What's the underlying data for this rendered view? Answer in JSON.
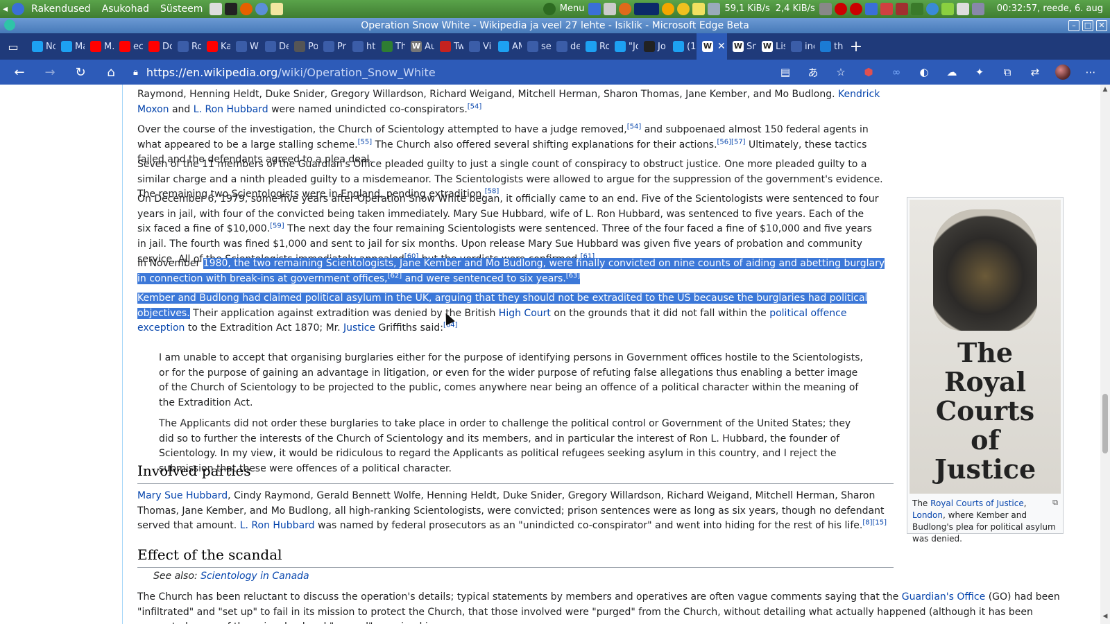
{
  "os_panel": {
    "menus": [
      "Rakendused",
      "Asukohad",
      "Süsteem"
    ],
    "menu_label": "Menu",
    "net_down": "59,1 KiB/s",
    "net_up": "2,4 KiB/s",
    "clock": "00:32:57, reede, 6. aug"
  },
  "window": {
    "title": "Operation Snow White - Wikipedia ja veel 27 lehte - Isiklik - Microsoft Edge Beta"
  },
  "tabs": [
    {
      "label": "No",
      "icon": "twitter-icon",
      "color": "#1da1f2"
    },
    {
      "label": "Ma",
      "icon": "twitter-icon",
      "color": "#1da1f2"
    },
    {
      "label": "M.",
      "icon": "youtube-icon",
      "color": "#ff0000"
    },
    {
      "label": "ec",
      "icon": "youtube-icon",
      "color": "#ff0000"
    },
    {
      "label": "Do",
      "icon": "youtube-icon",
      "color": "#ff0000"
    },
    {
      "label": "Ro",
      "icon": "speaker-icon",
      "color": "#3b5da8"
    },
    {
      "label": "Ka",
      "icon": "youtube-icon",
      "color": "#ff0000"
    },
    {
      "label": "W",
      "icon": "trash-icon",
      "color": "#3b5da8"
    },
    {
      "label": "De",
      "icon": "globe-icon",
      "color": "#3b5da8"
    },
    {
      "label": "Po",
      "icon": "bookmark-icon",
      "color": "#555555"
    },
    {
      "label": "Pr",
      "icon": "cloud-icon",
      "color": "#3b5da8"
    },
    {
      "label": "ht",
      "icon": "page-icon",
      "color": "#3b5da8"
    },
    {
      "label": "Th",
      "icon": "green-icon",
      "color": "#2e7d32"
    },
    {
      "label": "Au",
      "icon": "wikipedia-icon",
      "color": "#777777"
    },
    {
      "label": "Tw",
      "icon": "gmail-icon",
      "color": "#c5221f"
    },
    {
      "label": "Vi",
      "icon": "plane-icon",
      "color": "#3b5da8"
    },
    {
      "label": "AM",
      "icon": "twitter-icon",
      "color": "#1da1f2"
    },
    {
      "label": "se",
      "icon": "lock-doc-icon",
      "color": "#3b5da8"
    },
    {
      "label": "de",
      "icon": "circle-icon",
      "color": "#3b5da8"
    },
    {
      "label": "Ro",
      "icon": "twitter-icon",
      "color": "#1da1f2"
    },
    {
      "label": "\"Jo",
      "icon": "twitter-icon",
      "color": "#1da1f2"
    },
    {
      "label": "Jo",
      "icon": "gp-icon",
      "color": "#222222"
    },
    {
      "label": "(1",
      "icon": "twitter-icon",
      "color": "#1da1f2"
    },
    {
      "label": "",
      "icon": "wikipedia-icon",
      "color": "#ffffff",
      "active": true
    },
    {
      "label": "Sn",
      "icon": "wikipedia-icon",
      "color": "#ffffff"
    },
    {
      "label": "Lis",
      "icon": "wikipedia-icon",
      "color": "#ffffff"
    },
    {
      "label": "inc",
      "icon": "page-icon",
      "color": "#3b5da8"
    },
    {
      "label": "thi",
      "icon": "bing-icon",
      "color": "#1b7bd4"
    }
  ],
  "toolbar": {
    "url_host": "https://en.wikipedia.org",
    "url_path": "/wiki/Operation_Snow_White"
  },
  "article": {
    "p0a": "Raymond, Henning Heldt, Duke Snider, Gregory Willardson, Richard Weigand, Mitchell Herman, Sharon Thomas, Jane Kember, and Mo Budlong.",
    "p0_link1": "Kendrick Moxon",
    "p0_and": "and",
    "p0_link2": "L. Ron Hubbard",
    "p0b": "were named unindicted co-conspirators.",
    "p0_ref": "[54]",
    "p1a": "Over the course of the investigation, the Church of Scientology attempted to have a judge removed,",
    "p1_ref1": "[54]",
    "p1b": "and subpoenaed almost 150 federal agents in what appeared to be a large stalling scheme.",
    "p1_ref2": "[55]",
    "p1c": "The Church also offered several shifting explanations for their actions.",
    "p1_ref3": "[56][57]",
    "p1d": "Ultimately, these tactics failed and the defendants agreed to a plea deal.",
    "p2": "Seven of the 11 members of the Guardian's Office pleaded guilty to just a single count of conspiracy to obstruct justice. One more pleaded guilty to a similar charge and a ninth pleaded guilty to a misdemeanor. The Scientologists were allowed to argue for the suppression of the government's evidence. The remaining two Scientologists were in England, pending extradition.",
    "p2_ref": "[58]",
    "p3a": "On December 6, 1979, some five years after Operation Snow White began, it officially came to an end. Five of the Scientologists were sentenced to four years in jail, with four of the convicted being taken immediately. Mary Sue Hubbard, wife of L. Ron Hubbard, was sentenced to five years. Each of the six faced a fine of $10,000.",
    "p3_ref1": "[59]",
    "p3b": "The next day the four remaining Scientologists were sentenced. Three of the four faced a fine of $10,000 and five years in jail. The fourth was fined $1,000 and sent to jail for six months. Upon release Mary Sue Hubbard was given five years of probation and community service. All of the Scientologists immediately appealed",
    "p3_ref2": "[60]",
    "p3c": "but the verdicts were confirmed.",
    "p3_ref3": "[61]",
    "p4_pre": "In November",
    "p4_sel": "1980, the two remaining Scientologists, Jane Kember and Mo Budlong, were finally convicted on nine counts of aiding and abetting burglary in connection with break-ins at government offices,",
    "p4_ref1": "[62]",
    "p4_sel2": "and were sentenced to six years.",
    "p4_ref2": "[63]",
    "p5_sel": "Kember and Budlong had claimed political asylum in the UK, arguing that they should not be extradited to the US because the burglaries had political objectives.",
    "p5a": "Their application against extradition was denied by the British",
    "p5_link1": "High Court",
    "p5b": "on the grounds that it did not fall within the",
    "p5_link2": "political offence exception",
    "p5c": "to the Extradition Act 1870; Mr.",
    "p5_link3": "Justice",
    "p5d": "Griffiths said:",
    "p5_ref": "[64]",
    "quote1": "I am unable to accept that organising burglaries either for the purpose of identifying persons in Government offices hostile to the Scientologists, or for the purpose of gaining an advantage in litigation, or even for the wider purpose of refuting false allegations thus enabling a better image of the Church of Scientology to be projected to the public, comes anywhere near being an offence of a political character within the meaning of the Extradition Act.",
    "quote2": "The Applicants did not order these burglaries to take place in order to challenge the political control or Government of the United States; they did so to further the interests of the Church of Scientology and its members, and in particular the interest of Ron L. Hubbard, the founder of Scientology. In my view, it would be ridiculous to regard the Applicants as political refugees seeking asylum in this country, and I reject the submission that these were offences of a political character.",
    "h_involved": "Involved parties",
    "inv_link1": "Mary Sue Hubbard",
    "inv_a": ", Cindy Raymond, Gerald Bennett Wolfe, Henning Heldt, Duke Snider, Gregory Willardson, Richard Weigand, Mitchell Herman, Sharon Thomas, Jane Kember, and Mo Budlong, all high-ranking Scientologists, were convicted; prison sentences were as long as six years, though no defendant served that amount.",
    "inv_link2": "L. Ron Hubbard",
    "inv_b": "was named by federal prosecutors as an \"unindicted co-conspirator\" and went into hiding for the rest of his life.",
    "inv_ref": "[8][15]",
    "h_effect": "Effect of the scandal",
    "see_also_prefix": "See also:",
    "see_also_link": "Scientology in Canada",
    "eff_a": "The Church has been reluctant to discuss the operation's details; typical statements by members and operatives are often vague comments saying that the",
    "eff_link": "Guardian's Office",
    "eff_b": "(GO) had been \"infiltrated\" and \"set up\" to fail in its mission to protect the Church, that those involved were \"purged\" from the Church, without detailing what actually happened (although it has been suggested many of those involved and \"purged\" remained in"
  },
  "thumb": {
    "engraved": [
      "The",
      "Royal",
      "Courts",
      "of",
      "Justice"
    ],
    "cap_pre": "The",
    "cap_link1": "Royal Courts of Justice",
    "cap_comma": ",",
    "cap_link2": "London",
    "cap_post": ", where Kember and Budlong's plea for political asylum was denied."
  }
}
